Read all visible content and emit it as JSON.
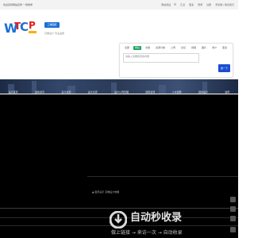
{
  "topbar": {
    "welcome": "欢迎来到网站目录 一键收录",
    "links": [
      "网站建设",
      "汇总",
      "更多",
      "登录",
      "注册"
    ],
    "extra": "手机端 | 联系我们"
  },
  "header": {
    "logo_text": "WTCP",
    "badge": "三维图纸",
    "slogan": "高端设计 专业品质"
  },
  "search": {
    "tabs": [
      "全部",
      "网址",
      "文章",
      "资源分类",
      "公司",
      "论坛",
      "视频",
      "图片",
      "商户",
      "更多"
    ],
    "active_tab": "网址",
    "placeholder": "请输入您要搜索的内容",
    "button": "搜一下"
  },
  "nav": {
    "items": [
      "设计首页",
      "最新资讯",
      "设计资源",
      "设计交流",
      "设计公司管理",
      "建筑表现",
      "人才招聘",
      "园林设计",
      "会所"
    ]
  },
  "main": {
    "screen_text": "▲ 夜景演示 高端设计效果"
  },
  "watermark": {
    "title": "自动秒收录",
    "subtitle": "做上链接 → 来访一次 → 自动收录"
  }
}
